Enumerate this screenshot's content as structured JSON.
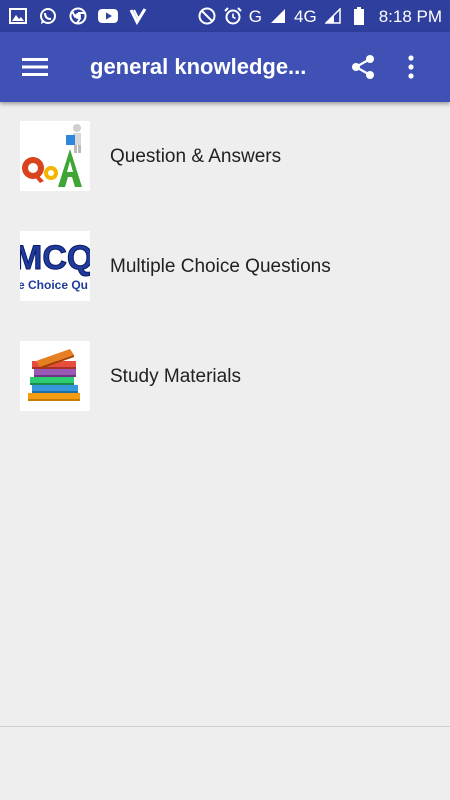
{
  "status_bar": {
    "signal_text": "G",
    "network_text": "4G",
    "time": "8:18 PM",
    "icons": [
      "image-icon",
      "whatsapp-icon",
      "chrome-icon",
      "youtube-icon",
      "vidmate-icon",
      "do-not-disturb-icon",
      "alarm-icon",
      "signal-icon",
      "battery-icon"
    ]
  },
  "app_bar": {
    "title": "general knowledge...",
    "menu_icon": "hamburger-menu-icon",
    "share_icon": "share-icon",
    "more_icon": "more-vert-icon"
  },
  "list": {
    "items": [
      {
        "label": "Question & Answers",
        "icon": "qa-letters-icon"
      },
      {
        "label": "Multiple Choice Questions",
        "icon": "mcq-logo-icon"
      },
      {
        "label": "Study Materials",
        "icon": "books-stack-icon"
      }
    ]
  },
  "mcq_logo": {
    "big_text": "MCQ",
    "small_text": "e Choice Qu"
  },
  "colors": {
    "status_bar": "#2f3f9e",
    "app_bar": "#3f51b5",
    "background": "#eeeeee",
    "text": "#212121"
  }
}
